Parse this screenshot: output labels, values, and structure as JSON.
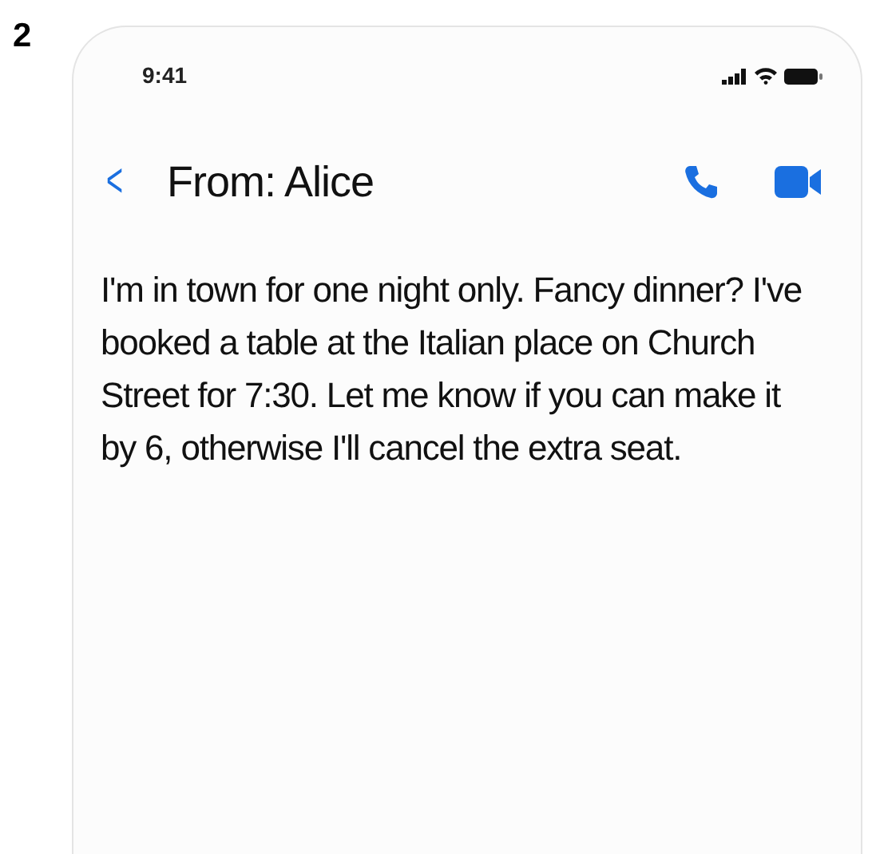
{
  "figure_label": "2",
  "status_bar": {
    "time": "9:41"
  },
  "header": {
    "back": "<",
    "title": "From: Alice"
  },
  "message": {
    "text": "I'm in town for one night only. Fancy dinner? I've booked a table at the Italian place on Church Street for 7:30. Let me know if you can make it by 6, otherwise I'll cancel the extra seat."
  }
}
